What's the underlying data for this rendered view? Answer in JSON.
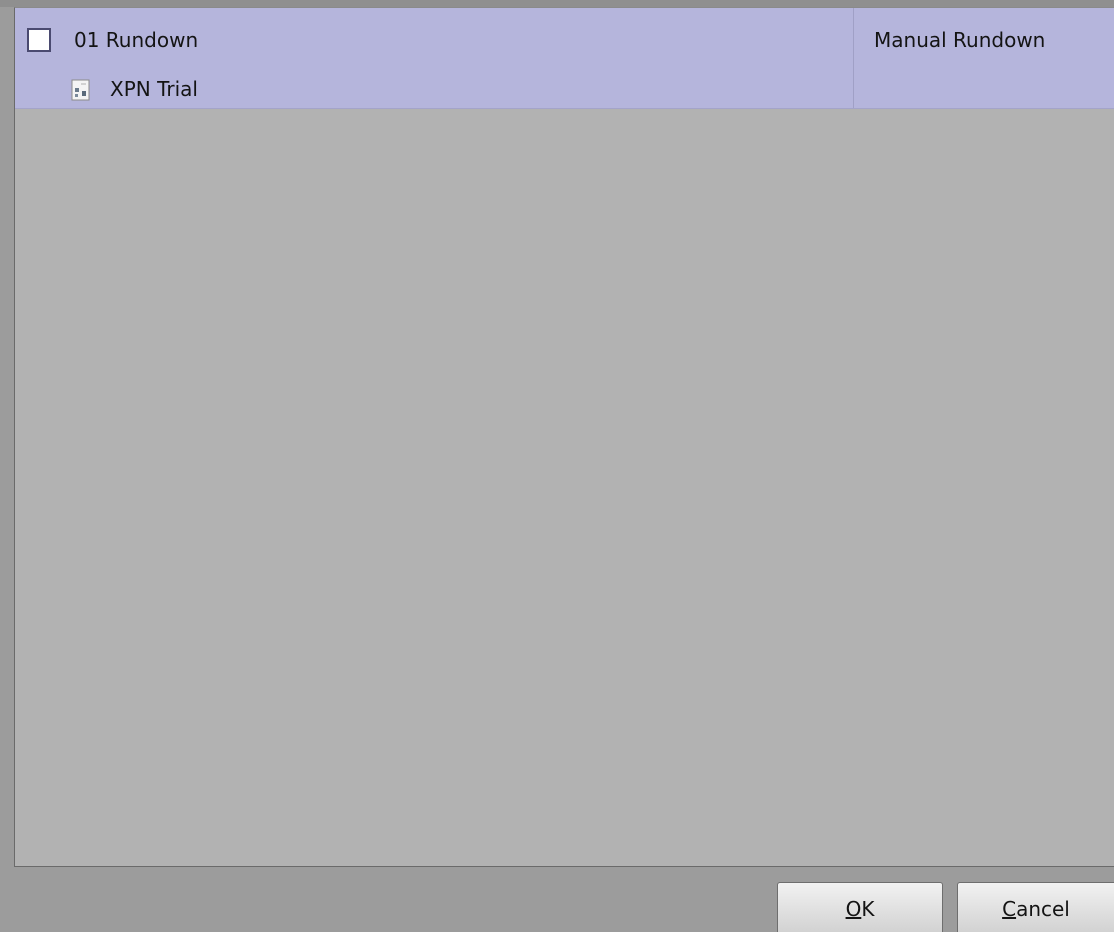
{
  "list": {
    "rows": [
      {
        "name": "01 Rundown",
        "checked": false,
        "child": {
          "icon": "rundown-document-icon",
          "label": "XPN Trial"
        },
        "type": "Manual Rundown"
      }
    ]
  },
  "buttons": {
    "ok_label": "OK",
    "cancel_label": "Cancel"
  },
  "colors": {
    "selected_row": "#b5b5dc",
    "list_background": "#b2b2b2",
    "dialog_background": "#9c9c9c"
  }
}
